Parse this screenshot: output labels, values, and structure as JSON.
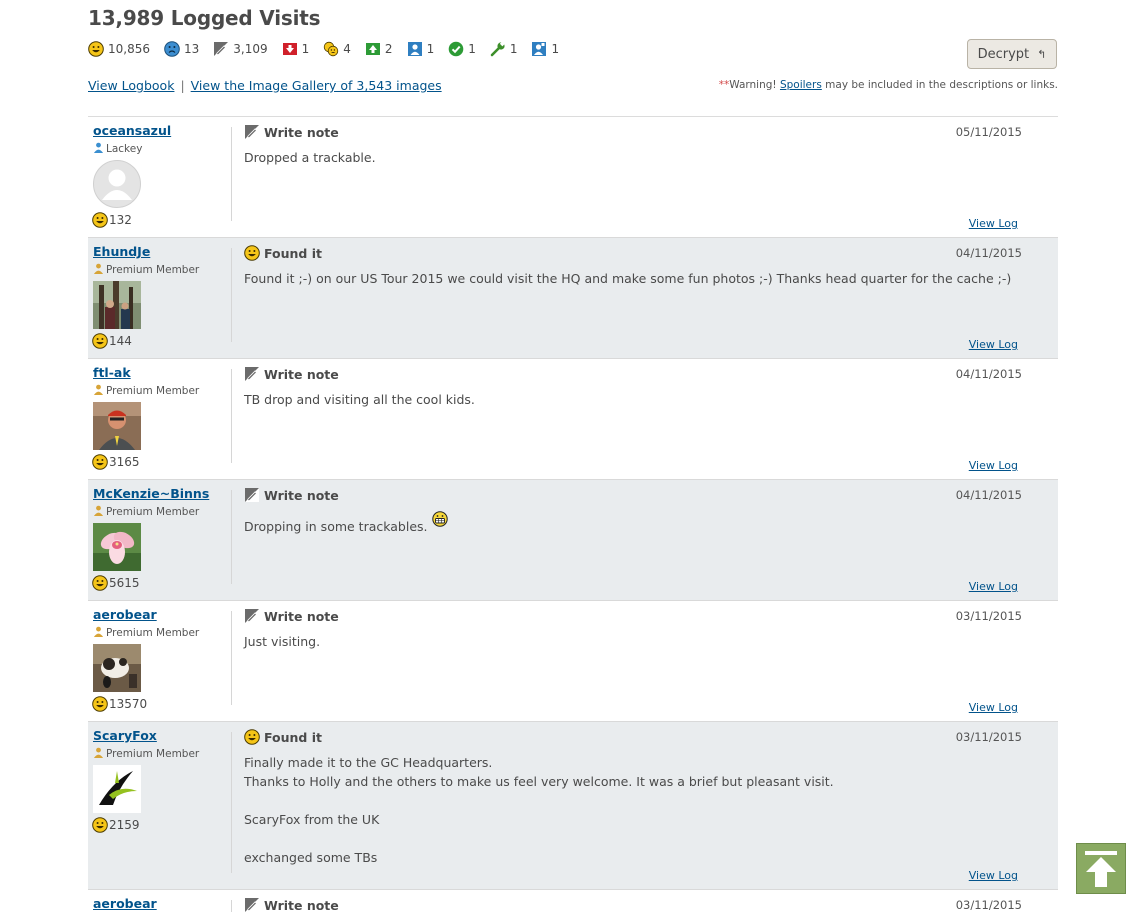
{
  "header": {
    "title": "13,989 Logged Visits",
    "decrypt_label": "Decrypt",
    "decrypt_icon": "return-arrow-icon"
  },
  "stats": [
    {
      "icon": "found-it-smiley-icon",
      "count": "10,856"
    },
    {
      "icon": "didnt-find-it-icon",
      "count": "13"
    },
    {
      "icon": "write-note-icon",
      "count": "3,109"
    },
    {
      "icon": "temporarily-disable-icon",
      "count": "1"
    },
    {
      "icon": "attended-group-icon",
      "count": "4"
    },
    {
      "icon": "enable-listing-icon",
      "count": "2"
    },
    {
      "icon": "publish-listing-icon",
      "count": "1"
    },
    {
      "icon": "owner-maintenance-check-icon",
      "count": "1"
    },
    {
      "icon": "maintenance-wrench-icon",
      "count": "1"
    },
    {
      "icon": "reviewer-note-icon",
      "count": "1"
    }
  ],
  "links": {
    "logbook": "View Logbook",
    "separator": "|",
    "gallery": "View the Image Gallery of 3,543 images"
  },
  "warning": {
    "stars": "**",
    "prefix": "Warning! ",
    "link": "Spoilers",
    "suffix": " may be included in the descriptions or links."
  },
  "colors": {
    "link": "#02538b",
    "alt_row": "#e9ecee",
    "smiley": "#f5c518",
    "back_to_top": "#8aaa62"
  },
  "logs": [
    {
      "user": "oceansazul",
      "role": "Lackey",
      "role_color": "#3a8fd0",
      "finds": "132",
      "type": "Write note",
      "type_icon": "write-note-icon",
      "date": "05/11/2015",
      "text": "Dropped a trackable.",
      "view_log": "View Log",
      "avatar": "default-avatar-icon",
      "height": 121
    },
    {
      "user": "EhundJe",
      "role": "Premium Member",
      "role_color": "#d7a438",
      "finds": "144",
      "type": "Found it",
      "type_icon": "found-it-smiley-icon",
      "date": "04/11/2015",
      "text": "Found it ;-) on our US Tour 2015 we could visit the HQ and make some fun photos ;-) Thanks head quarter for the cache ;-)",
      "view_log": "View Log",
      "avatar": "photo-forest-avatar",
      "height": 121
    },
    {
      "user": "ftl-ak",
      "role": "Premium Member",
      "role_color": "#d7a438",
      "finds": "3165",
      "type": "Write note",
      "type_icon": "write-note-icon",
      "date": "04/11/2015",
      "text": "TB drop and visiting all the cool kids.",
      "view_log": "View Log",
      "avatar": "photo-man-avatar",
      "height": 121
    },
    {
      "user": "McKenzie~Binns",
      "role": "Premium Member",
      "role_color": "#d7a438",
      "finds": "5615",
      "type": "Write note",
      "type_icon": "write-note-icon",
      "date": "04/11/2015",
      "text": "Dropping in some trackables.",
      "view_log": "View Log",
      "avatar": "photo-flower-avatar",
      "height": 121,
      "emoji": "grin-emoticon-icon"
    },
    {
      "user": "aerobear",
      "role": "Premium Member",
      "role_color": "#d7a438",
      "finds": "13570",
      "type": "Write note",
      "type_icon": "write-note-icon",
      "date": "03/11/2015",
      "text": "Just visiting.",
      "view_log": "View Log",
      "avatar": "photo-dog-avatar",
      "height": 121
    },
    {
      "user": "ScaryFox",
      "role": "Premium Member",
      "role_color": "#d7a438",
      "finds": "2159",
      "type": "Found it",
      "type_icon": "found-it-smiley-icon",
      "date": "03/11/2015",
      "text": "Finally made it to the GC Headquarters.\nThanks to Holly and the others to make us feel very welcome. It was a brief but pleasant visit.\n\nScaryFox from the UK\n\nexchanged some TBs",
      "view_log": "View Log",
      "avatar": "logo-swoosh-avatar",
      "height": 168
    },
    {
      "user": "aerobear",
      "role": "",
      "role_color": "#d7a438",
      "finds": "",
      "type": "Write note",
      "type_icon": "write-note-icon",
      "date": "03/11/2015",
      "text": "",
      "view_log": "",
      "avatar": "",
      "height": 40
    }
  ],
  "back_to_top": {
    "icon": "arrow-up-to-top-icon"
  }
}
